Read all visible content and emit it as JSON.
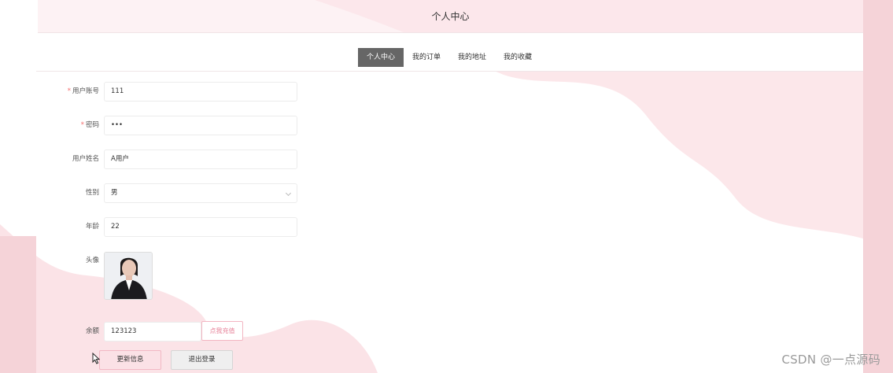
{
  "page": {
    "title": "个人中心",
    "accent_color": "#666666",
    "background_accent": "#fbe3e7"
  },
  "tabs": [
    {
      "label": "个人中心",
      "active": true
    },
    {
      "label": "我的订单",
      "active": false
    },
    {
      "label": "我的地址",
      "active": false
    },
    {
      "label": "我的收藏",
      "active": false
    }
  ],
  "form": {
    "account": {
      "label": "用户账号",
      "value": "111",
      "required": true
    },
    "password": {
      "label": "密码",
      "value": "•••",
      "required": true
    },
    "name": {
      "label": "用户姓名",
      "value": "A用户"
    },
    "gender": {
      "label": "性别",
      "value": "男",
      "icon": "chevron-down-icon"
    },
    "age": {
      "label": "年龄",
      "value": "22"
    },
    "avatar": {
      "label": "头像"
    },
    "balance": {
      "label": "余额",
      "value": "123123",
      "recharge_label": "点我充值"
    },
    "required_mark": "*"
  },
  "actions": {
    "update_label": "更新信息",
    "logout_label": "退出登录"
  },
  "watermark": "CSDN @一点源码"
}
